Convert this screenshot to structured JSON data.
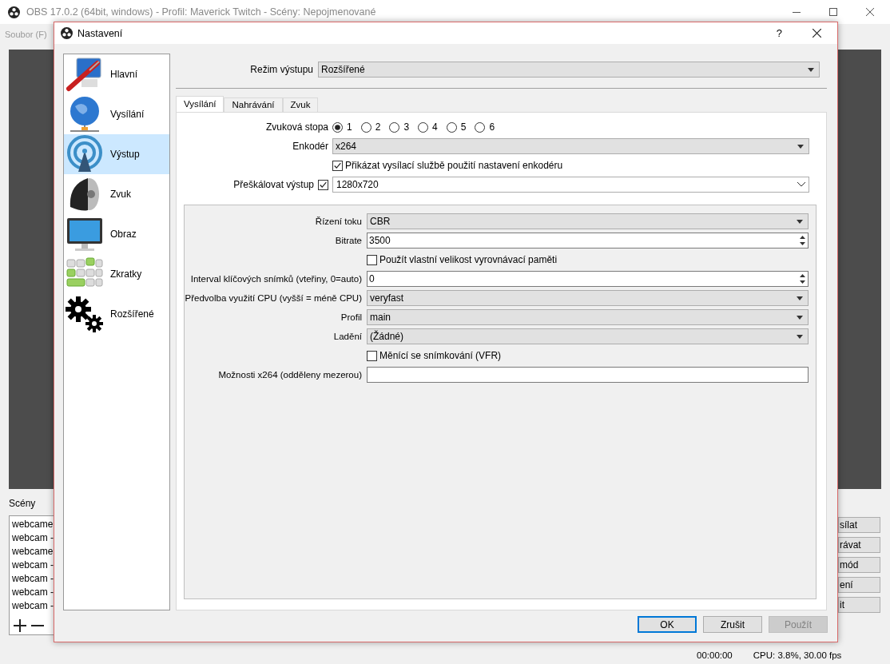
{
  "main_window": {
    "title": "OBS 17.0.2 (64bit, windows) - Profil: Maverick Twitch - Scény: Nepojmenované",
    "menu": [
      "Soubor (F)"
    ],
    "scenes_label": "Scény",
    "scenes": [
      "webcame",
      "webcam -",
      "webcame",
      "webcam -",
      "webcam -",
      "webcam -",
      "webcam -"
    ],
    "controls": [
      "sílat",
      "rávat",
      "mód",
      "ení",
      "it"
    ],
    "status_bar": [
      "00:00:00",
      "CPU: 3.8%, 30.00 fps"
    ]
  },
  "dialog": {
    "title": "Nastavení",
    "help": "?",
    "sidebar": [
      {
        "label": "Hlavní",
        "kind": "general",
        "selected": false
      },
      {
        "label": "Vysílání",
        "kind": "globe",
        "selected": false
      },
      {
        "label": "Výstup",
        "kind": "signal",
        "selected": true
      },
      {
        "label": "Zvuk",
        "kind": "speaker",
        "selected": false
      },
      {
        "label": "Obraz",
        "kind": "monitor",
        "selected": false
      },
      {
        "label": "Zkratky",
        "kind": "keys",
        "selected": false
      },
      {
        "label": "Rozšířené",
        "kind": "gears",
        "selected": false
      }
    ],
    "output_mode": {
      "label": "Režim výstupu",
      "value": "Rozšířené"
    },
    "tabs": [
      {
        "label": "Vysílání",
        "selected": true
      },
      {
        "label": "Nahrávání",
        "selected": false
      },
      {
        "label": "Zvuk",
        "selected": false
      }
    ],
    "audio_track": {
      "label": "Zvuková stopa",
      "options": [
        {
          "label": "1",
          "selected": true
        },
        {
          "label": "2",
          "selected": false
        },
        {
          "label": "3",
          "selected": false
        },
        {
          "label": "4",
          "selected": false
        },
        {
          "label": "5",
          "selected": false
        },
        {
          "label": "6",
          "selected": false
        }
      ]
    },
    "encoder": {
      "label": "Enkodér",
      "value": "x264"
    },
    "enforce": {
      "label": "Přikázat vysílací službě použití nastavení enkodéru",
      "checked": true
    },
    "rescale": {
      "label": "Přeškálovat výstup",
      "checked": true,
      "value": "1280x720"
    },
    "encoder_settings": [
      {
        "kind": "dropdown",
        "label": "Řízení toku",
        "value": "CBR"
      },
      {
        "kind": "spin",
        "label": "Bitrate",
        "value": "3500"
      },
      {
        "kind": "checkbox",
        "label": "Použít vlastní velikost vyrovnávací paměti",
        "checked": false
      },
      {
        "kind": "spin",
        "label": "Interval klíčových snímků (vteřiny, 0=auto)",
        "value": "0"
      },
      {
        "kind": "dropdown",
        "label": "Předvolba využití CPU (vyšší = méně CPU)",
        "value": "veryfast"
      },
      {
        "kind": "dropdown",
        "label": "Profil",
        "value": "main"
      },
      {
        "kind": "dropdown",
        "label": "Ladění",
        "value": "(Žádné)"
      },
      {
        "kind": "checkbox",
        "label": "Měnící se snímkování (VFR)",
        "checked": false
      },
      {
        "kind": "text",
        "label": "Možnosti x264 (odděleny mezerou)"
      }
    ],
    "buttons": [
      {
        "label": "OK",
        "default": true,
        "disabled": false
      },
      {
        "label": "Zrušit",
        "default": false,
        "disabled": false
      },
      {
        "label": "Použít",
        "default": false,
        "disabled": true
      }
    ]
  }
}
